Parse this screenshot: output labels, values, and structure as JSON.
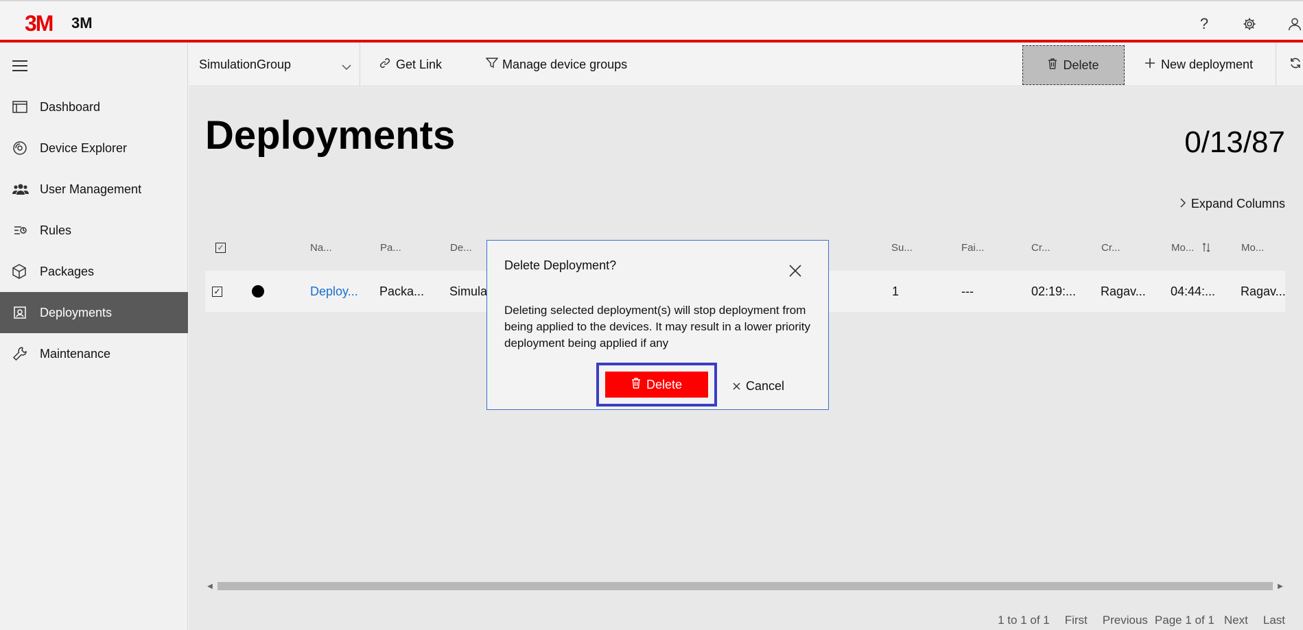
{
  "header": {
    "logo_mark": "3M",
    "logo_text": "3M",
    "icons": [
      "help-icon",
      "gear-icon",
      "user-icon"
    ],
    "help_glyph": "?"
  },
  "sidebar": {
    "items": [
      {
        "label": "Dashboard",
        "icon": "dashboard-icon",
        "active": false
      },
      {
        "label": "Device Explorer",
        "icon": "device-explorer-icon",
        "active": false
      },
      {
        "label": "User Management",
        "icon": "users-icon",
        "active": false
      },
      {
        "label": "Rules",
        "icon": "rules-icon",
        "active": false
      },
      {
        "label": "Packages",
        "icon": "package-icon",
        "active": false
      },
      {
        "label": "Deployments",
        "icon": "deployments-icon",
        "active": true
      },
      {
        "label": "Maintenance",
        "icon": "maintenance-icon",
        "active": false
      }
    ]
  },
  "toolbar": {
    "device_group": "SimulationGroup",
    "get_link": "Get Link",
    "manage_groups": "Manage device groups",
    "delete": "Delete",
    "new_deployment": "New deployment"
  },
  "main": {
    "title": "Deployments",
    "counter": "0/13/87",
    "expand_columns": "Expand Columns",
    "columns": [
      "Na...",
      "Pa...",
      "De...",
      "Su...",
      "Fai...",
      "Cr...",
      "Cr...",
      "Mo...",
      "Mo..."
    ],
    "row": {
      "name": "Deploy...",
      "package": "Packa...",
      "description": "Simula",
      "succeeded": "1",
      "failed": "---",
      "created_time": "02:19:...",
      "created_by": "Ragav...",
      "modified_time": "04:44:...",
      "modified_by": "Ragav..."
    },
    "pager": {
      "summary": "1 to 1 of 1",
      "first": "First",
      "previous": "Previous",
      "page": "Page 1 of 1",
      "next": "Next",
      "last": "Last"
    }
  },
  "modal": {
    "title": "Delete Deployment?",
    "body": "Deleting selected deployment(s) will stop deployment from being applied to the devices. It may result in a lower priority deployment being applied if any",
    "delete_label": "Delete",
    "cancel_label": "Cancel"
  },
  "colors": {
    "brand_red": "#e60000",
    "delete_red": "#ff0000",
    "link_blue": "#1a6fd1",
    "active_nav": "#595959",
    "focus_ring": "#3a3fc4"
  }
}
